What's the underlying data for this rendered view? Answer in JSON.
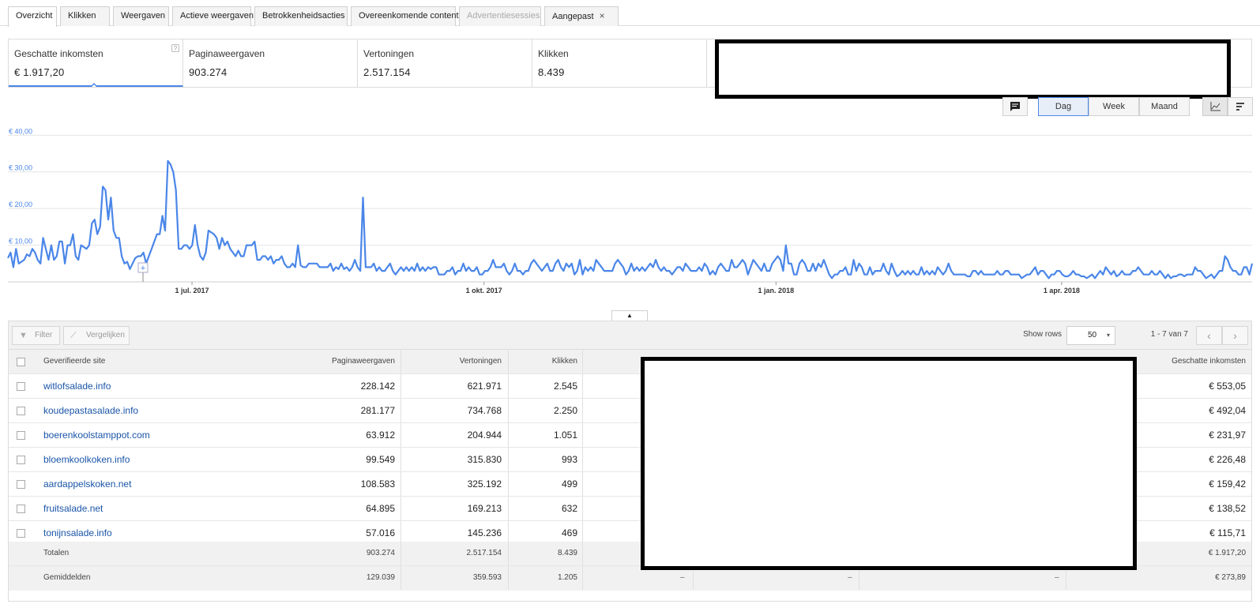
{
  "tabs": [
    {
      "label": "Overzicht",
      "state": "active"
    },
    {
      "label": "Klikken",
      "state": "normal"
    },
    {
      "label": "Weergaven",
      "state": "normal"
    },
    {
      "label": "Actieve weergaven",
      "state": "normal"
    },
    {
      "label": "Betrokkenheidsacties",
      "state": "normal"
    },
    {
      "label": "Overeenkomende content",
      "state": "normal"
    },
    {
      "label": "Advertentiesessies",
      "state": "disabled"
    },
    {
      "label": "Aangepast",
      "state": "normal",
      "close_icon": "close-icon",
      "close_glyph": "×"
    }
  ],
  "scorecards": [
    {
      "label": "Geschatte inkomsten",
      "value": "€ 1.917,20",
      "help": "?"
    },
    {
      "label": "Paginaweergaven",
      "value": "903.274"
    },
    {
      "label": "Vertoningen",
      "value": "2.517.154"
    },
    {
      "label": "Klikken",
      "value": "8.439"
    }
  ],
  "toolbar": {
    "comment_icon": "comment-icon",
    "granularity": [
      "Dag",
      "Week",
      "Maand"
    ],
    "selected": "Dag",
    "line_icon": "line-chart-icon",
    "bar_icon": "bar-chart-icon"
  },
  "chart_data": {
    "type": "line",
    "series_color": "#4a86e8",
    "y_ticks": [
      "€ 40,00",
      "€ 30,00",
      "€ 20,00",
      "€ 10,00"
    ],
    "ylim": [
      0,
      42
    ],
    "x_ticks": [
      "1 jul. 2017",
      "1 okt. 2017",
      "1 jan. 2018",
      "1 apr. 2018"
    ],
    "grid": true,
    "values": [
      6.5,
      8,
      4,
      9,
      5,
      5.5,
      6,
      7.5,
      7,
      9,
      8,
      6,
      5,
      12,
      9,
      6,
      10,
      6,
      7,
      11,
      11,
      5,
      10,
      10,
      13,
      7,
      6,
      10,
      9.5,
      9,
      10,
      16,
      17,
      13,
      15,
      26,
      25,
      17,
      23,
      14,
      12,
      12,
      7,
      5,
      5.5,
      3.5,
      5,
      6.5,
      7,
      7,
      8,
      5,
      7,
      9,
      11,
      13,
      13,
      18,
      14,
      33,
      32,
      30,
      25,
      9,
      9,
      10,
      10,
      9,
      10,
      15.5,
      10,
      7,
      6,
      8,
      14,
      13.5,
      13,
      12,
      9,
      12,
      10,
      11,
      9,
      8,
      7,
      8.5,
      7,
      7,
      10,
      10,
      10,
      11,
      6,
      6,
      7,
      7,
      6,
      7,
      5,
      6,
      6,
      7,
      5,
      4,
      4,
      5,
      4,
      10,
      4.5,
      4,
      4,
      5,
      5,
      5,
      5,
      4,
      4,
      4,
      4,
      5,
      3,
      4,
      3.5,
      5,
      3.5,
      4,
      3,
      4,
      6,
      4,
      3,
      23,
      4,
      4,
      4,
      5,
      3,
      4,
      3,
      3,
      4,
      5,
      3,
      2,
      3,
      4,
      3,
      4,
      3,
      4,
      3,
      5,
      3,
      4,
      3,
      4,
      3.5,
      4,
      4,
      2,
      2,
      2,
      3,
      3,
      4,
      2,
      3,
      3,
      5,
      3,
      4,
      3,
      3,
      4,
      2,
      2,
      3,
      3,
      4,
      6,
      4,
      4,
      4,
      5,
      3,
      2,
      3,
      5,
      3,
      3,
      2,
      3,
      3,
      5,
      6,
      5,
      4,
      3,
      4,
      5,
      3,
      3,
      5,
      6,
      4,
      3,
      5,
      4,
      5,
      2,
      3,
      6,
      2,
      4,
      3,
      4,
      3,
      6,
      5,
      4,
      3,
      3,
      3,
      3,
      5,
      6,
      5,
      4,
      2,
      3,
      5,
      3,
      4,
      3,
      4,
      3,
      4,
      5,
      4,
      6,
      4,
      3,
      4,
      3,
      3,
      2,
      3,
      4,
      4,
      3,
      5,
      4,
      3,
      3,
      3,
      4,
      3,
      5,
      4,
      2,
      3,
      2,
      4,
      5,
      4,
      3,
      3,
      6,
      4,
      4,
      5,
      6,
      5,
      2,
      4,
      6,
      5,
      4,
      3,
      5,
      3,
      3,
      5,
      6,
      7,
      6,
      3,
      10,
      5,
      5,
      2,
      2,
      5,
      6,
      5,
      3,
      3,
      5,
      3,
      5,
      4,
      6,
      4,
      2,
      1,
      2,
      2,
      3,
      3,
      4,
      2,
      2,
      6,
      3,
      5,
      4,
      2,
      2,
      4,
      2,
      3,
      3,
      3,
      5,
      3,
      2,
      5,
      3,
      1.5,
      2,
      3,
      2,
      3,
      2,
      3,
      2,
      2,
      4,
      2,
      3,
      2,
      3,
      2,
      4,
      3,
      2,
      3,
      5,
      3,
      2,
      2,
      2,
      2,
      2,
      1.5,
      1.5,
      3,
      3,
      2,
      3,
      2,
      2,
      2,
      2,
      2,
      3,
      2,
      2,
      3,
      3,
      2,
      2,
      2,
      2,
      1,
      1.5,
      2,
      2,
      3,
      4,
      2,
      3,
      3,
      2,
      1,
      2,
      2,
      3,
      3,
      2,
      1.5,
      1.5,
      2,
      3,
      2,
      2,
      1.5,
      1.5,
      1,
      1.5,
      2,
      1,
      2,
      3,
      2,
      4,
      3,
      2,
      3,
      1.5,
      2,
      3,
      2,
      2,
      2,
      3,
      3,
      4,
      3,
      2,
      2,
      2,
      3,
      2,
      2,
      3,
      2,
      1,
      2,
      1,
      1.5,
      1.5,
      2,
      2,
      1.5,
      2,
      2,
      2,
      4,
      3,
      3,
      2,
      1,
      1.5,
      2,
      1,
      2,
      3,
      3,
      7,
      6,
      4,
      3,
      3,
      2,
      2,
      4,
      4,
      2,
      5
    ]
  },
  "table": {
    "filter_label": "Filter",
    "filter_icon": "filter-icon",
    "compare_label": "Vergelijken",
    "compare_icon": "compare-icon",
    "show_rows_label": "Show rows",
    "rows_value": "50",
    "page_info": "1 - 7 van 7",
    "prev_icon": "chevron-left-icon",
    "next_icon": "chevron-right-icon",
    "columns": [
      "Geverifieerde site",
      "Paginaweergaven",
      "Vertoningen",
      "Klikken",
      "Geschatte inkomsten"
    ],
    "rows": [
      {
        "site": "witlofsalade.info",
        "pv": "228.142",
        "imp": "621.971",
        "clicks": "2.545",
        "rev": "€ 553,05"
      },
      {
        "site": "koudepastasalade.info",
        "pv": "281.177",
        "imp": "734.768",
        "clicks": "2.250",
        "rev": "€ 492,04"
      },
      {
        "site": "boerenkoolstamppot.com",
        "pv": "63.912",
        "imp": "204.944",
        "clicks": "1.051",
        "rev": "€ 231,97"
      },
      {
        "site": "bloemkoolkoken.info",
        "pv": "99.549",
        "imp": "315.830",
        "clicks": "993",
        "rev": "€ 226,48"
      },
      {
        "site": "aardappelskoken.net",
        "pv": "108.583",
        "imp": "325.192",
        "clicks": "499",
        "rev": "€ 159,42"
      },
      {
        "site": "fruitsalade.net",
        "pv": "64.895",
        "imp": "169.213",
        "clicks": "632",
        "rev": "€ 138,52"
      },
      {
        "site": "tonijnsalade.info",
        "pv": "57.016",
        "imp": "145.236",
        "clicks": "469",
        "rev": "€ 115,71"
      }
    ],
    "totals": {
      "label": "Totalen",
      "pv": "903.274",
      "imp": "2.517.154",
      "clicks": "8.439",
      "rev": "€ 1.917,20"
    },
    "averages": {
      "label": "Gemiddelden",
      "pv": "129.039",
      "imp": "359.593",
      "clicks": "1.205",
      "dash": "–",
      "rev": "€ 273,89"
    }
  }
}
